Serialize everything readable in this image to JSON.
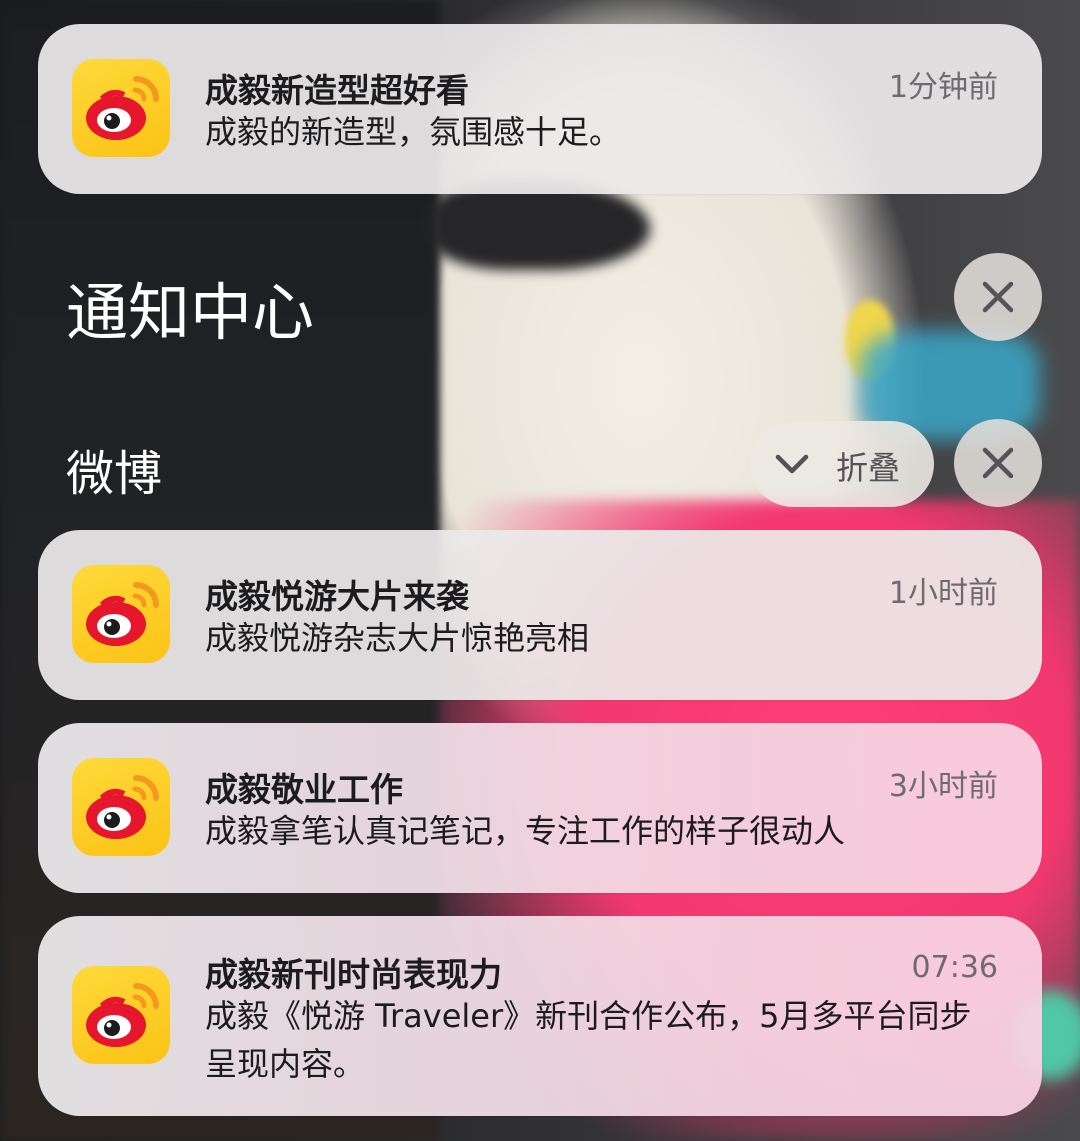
{
  "notification_center": {
    "title": "通知中心"
  },
  "top_notification": {
    "title": "成毅新造型超好看",
    "body": "成毅的新造型，氛围感十足。",
    "time": "1分钟前"
  },
  "group": {
    "app_name": "微博",
    "collapse_label": "折叠",
    "notifications": [
      {
        "title": "成毅悦游大片来袭",
        "body": "成毅悦游杂志大片惊艳亮相",
        "time": "1小时前"
      },
      {
        "title": "成毅敬业工作",
        "body": "成毅拿笔认真记笔记，专注工作的样子很动人",
        "time": "3小时前"
      },
      {
        "title": "成毅新刊时尚表现力",
        "body": "成毅《悦游 Traveler》新刊合作公布，5月多平台同步呈现内容。",
        "time": "07:36"
      }
    ]
  },
  "icons": {
    "app_icon": "weibo-icon",
    "clear_all": "close-icon",
    "clear_group": "close-icon",
    "collapse": "chevron-down-icon"
  },
  "colors": {
    "weibo_yellow": "#fbc315",
    "weibo_red": "#e6162d"
  }
}
